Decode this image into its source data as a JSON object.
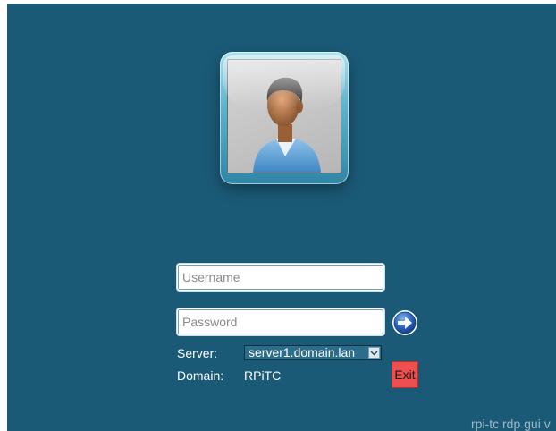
{
  "login": {
    "username_placeholder": "Username",
    "password_placeholder": "Password",
    "server_label": "Server:",
    "server_selected": "server1.domain.lan",
    "domain_label": "Domain:",
    "domain_value": "RPiTC",
    "exit_label": "Exit"
  },
  "footer": {
    "text": "rpi-tc rdp gui v"
  },
  "icons": {
    "avatar": "user-avatar-icon",
    "submit": "arrow-right-icon",
    "dropdown": "chevron-down-icon"
  },
  "colors": {
    "background": "#1b5a77",
    "exit_button": "#ef4f4f"
  }
}
